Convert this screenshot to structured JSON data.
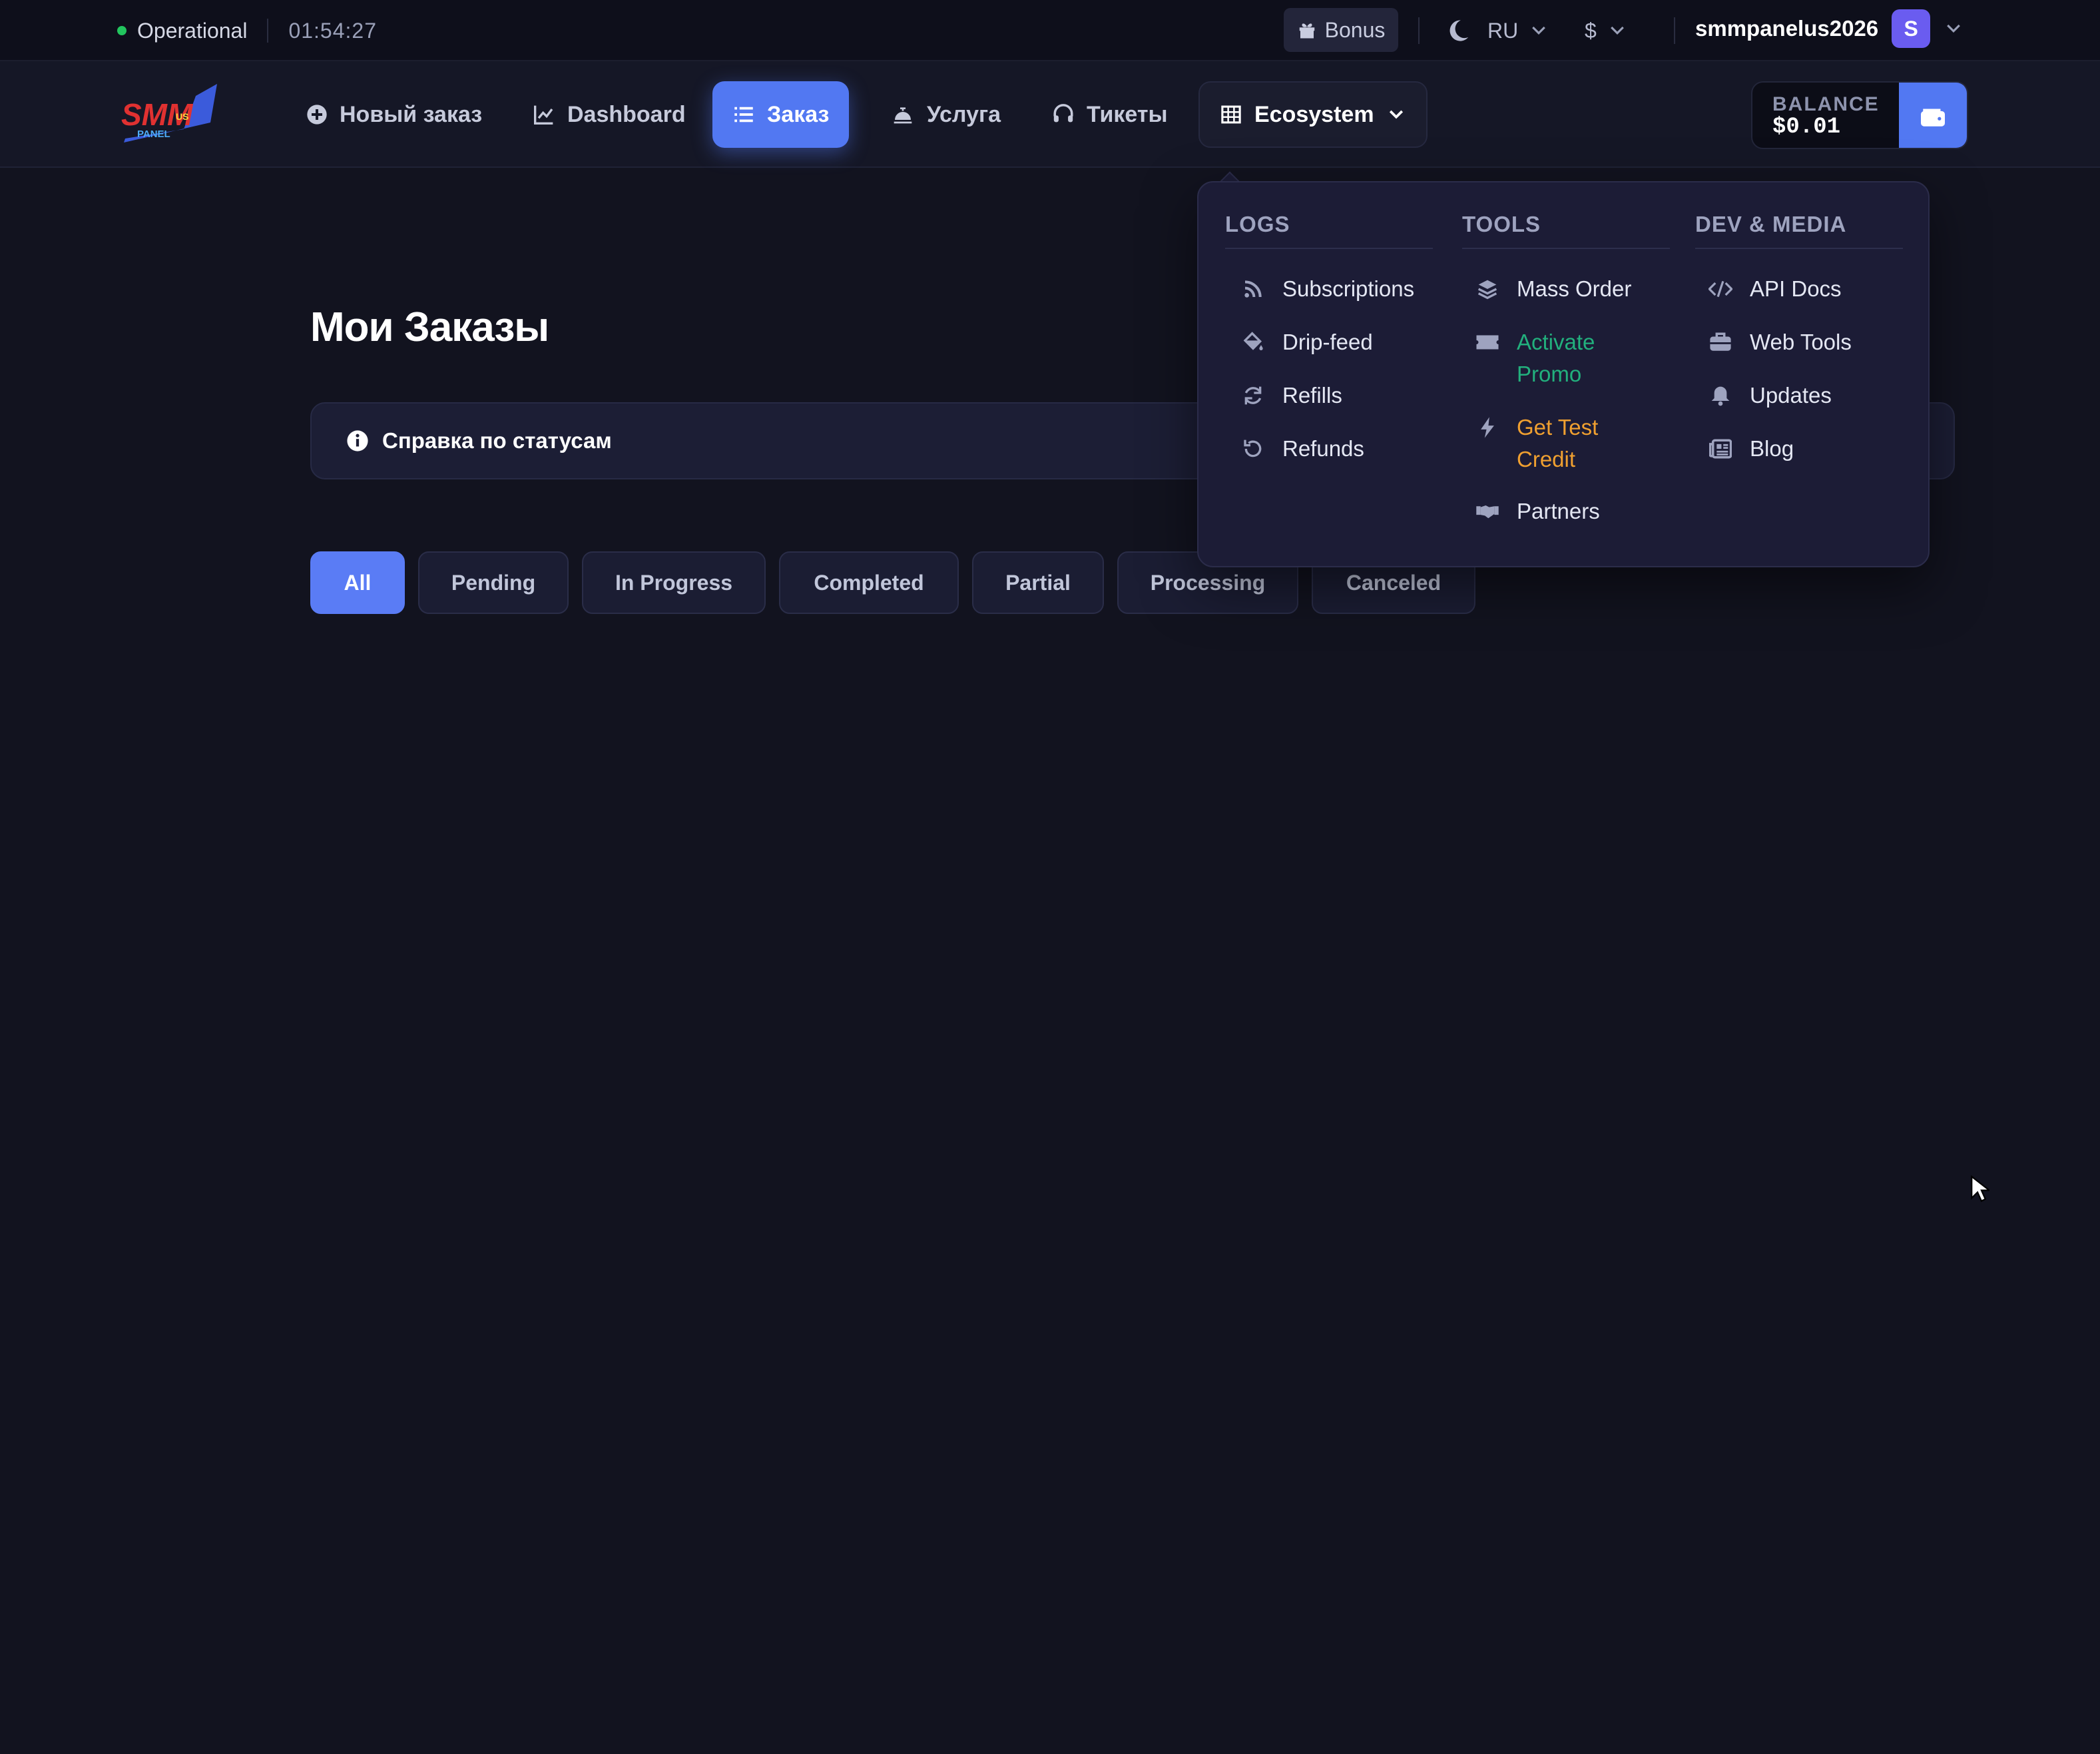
{
  "status": {
    "text": "Operational",
    "time": "01:54:27"
  },
  "topbar": {
    "bonus_label": "Bonus",
    "language": "RU",
    "currency": "$",
    "username": "smmpanelus2026",
    "avatar_letter": "S"
  },
  "nav": {
    "items": [
      {
        "label": "Новый заказ",
        "icon": "plus-circle-icon"
      },
      {
        "label": "Dashboard",
        "icon": "chart-line-icon"
      },
      {
        "label": "Заказ",
        "icon": "list-icon",
        "active": true
      },
      {
        "label": "Услуга",
        "icon": "bell-concierge-icon"
      },
      {
        "label": "Тикеты",
        "icon": "headset-icon"
      },
      {
        "label": "Ecosystem",
        "icon": "grid-icon"
      }
    ],
    "balance_label": "BALANCE",
    "balance_amount": "$0.01"
  },
  "main": {
    "title": "Мои Заказы",
    "help_text": "Справка по статусам",
    "filters": [
      "All",
      "Pending",
      "In Progress",
      "Completed",
      "Partial",
      "Processing",
      "Canceled"
    ],
    "active_filter": "All"
  },
  "ecosystem_menu": {
    "logs": {
      "heading": "LOGS",
      "items": [
        {
          "label": "Subscriptions",
          "icon": "rss-icon"
        },
        {
          "label": "Drip-feed",
          "icon": "fill-drip-icon"
        },
        {
          "label": "Refills",
          "icon": "refresh-icon"
        },
        {
          "label": "Refunds",
          "icon": "undo-icon"
        }
      ]
    },
    "tools": {
      "heading": "TOOLS",
      "items": [
        {
          "label": "Mass Order",
          "icon": "layers-icon"
        },
        {
          "label": "Activate Promo",
          "icon": "ticket-icon",
          "color": "#22b07d"
        },
        {
          "label": "Get Test Credit",
          "icon": "bolt-icon",
          "color": "#f0a030"
        },
        {
          "label": "Partners",
          "icon": "handshake-icon"
        }
      ]
    },
    "dev_media": {
      "heading": "DEV & MEDIA",
      "items": [
        {
          "label": "API Docs",
          "icon": "code-icon"
        },
        {
          "label": "Web Tools",
          "icon": "toolbox-icon"
        },
        {
          "label": "Updates",
          "icon": "bell-icon"
        },
        {
          "label": "Blog",
          "icon": "newspaper-icon"
        }
      ]
    }
  },
  "colors": {
    "accent": "#5278f2",
    "background": "#12131f",
    "status_ok": "#22c55e",
    "promo": "#22b07d",
    "credit": "#f0a030"
  }
}
